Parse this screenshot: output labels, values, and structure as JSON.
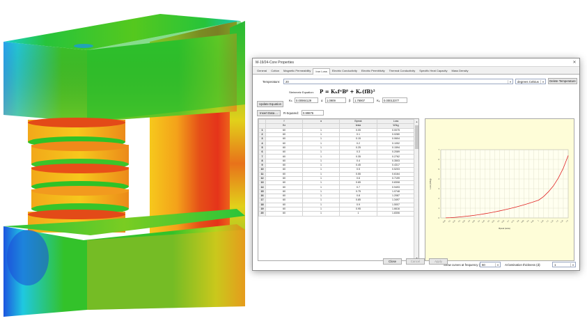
{
  "window": {
    "title": "M-19/24-Core Properties",
    "close_glyph": "✕"
  },
  "tabs": [
    {
      "label": "General"
    },
    {
      "label": "Cotton"
    },
    {
      "label": "Magnetic Permeability"
    },
    {
      "label": "Iron Loss",
      "active": true
    },
    {
      "label": "Electric Conductivity"
    },
    {
      "label": "Electric Permittivity"
    },
    {
      "label": "Thermal Conductivity"
    },
    {
      "label": "Specific Heat Capacity"
    },
    {
      "label": "Mass Density"
    }
  ],
  "temperature": {
    "label": "Temperature:",
    "value": "20",
    "unit": "degrees Celsius",
    "delete_button": "Delete Temperature"
  },
  "equation": {
    "label": "Steinmetz Equation:",
    "formula": "P = KₕfᵅBᵝ + Kₑ(fB)²",
    "update_button": "Update Equation",
    "params": [
      {
        "name": "Kₕ",
        "value": "0.00984129"
      },
      {
        "name": "α",
        "value": "1.0909"
      },
      {
        "name": "β",
        "value": "1.76907"
      },
      {
        "name": "Kₑ",
        "value": "0.00013377"
      }
    ]
  },
  "fit": {
    "insert_button": "Insert Data ...",
    "r_squared_label": "R-Squared:",
    "r_squared_value": "0.99876"
  },
  "table": {
    "headers": [
      "f",
      "α",
      "Bpeak",
      "Loss"
    ],
    "units": [
      "Hz",
      "",
      "tesla",
      "W/kg"
    ],
    "rows": [
      [
        "1",
        "60",
        "1",
        "0.05",
        "0.0075"
      ],
      [
        "2",
        "60",
        "1",
        "0.1",
        "0.0280"
      ],
      [
        "3",
        "60",
        "1",
        "0.15",
        "0.0604"
      ],
      [
        "4",
        "60",
        "1",
        "0.2",
        "0.1052"
      ],
      [
        "5",
        "60",
        "1",
        "0.25",
        "0.1594"
      ],
      [
        "6",
        "60",
        "1",
        "0.3",
        "0.2089"
      ],
      [
        "7",
        "60",
        "1",
        "0.35",
        "0.2762"
      ],
      [
        "8",
        "60",
        "1",
        "0.4",
        "0.3503"
      ],
      [
        "9",
        "60",
        "1",
        "0.45",
        "0.4317"
      ],
      [
        "10",
        "60",
        "1",
        "0.5",
        "0.5203"
      ],
      [
        "11",
        "60",
        "1",
        "0.55",
        "0.6164"
      ],
      [
        "12",
        "60",
        "1",
        "0.6",
        "0.7199"
      ],
      [
        "13",
        "60",
        "1",
        "0.65",
        "0.8308"
      ],
      [
        "14",
        "60",
        "1",
        "0.7",
        "0.9493"
      ],
      [
        "15",
        "60",
        "1",
        "0.75",
        "1.0748"
      ],
      [
        "16",
        "60",
        "1",
        "0.8",
        "1.2087"
      ],
      [
        "17",
        "60",
        "1",
        "0.85",
        "1.3497"
      ],
      [
        "18",
        "60",
        "1",
        "0.9",
        "1.5007"
      ],
      [
        "19",
        "60",
        "1",
        "0.95",
        "1.6616"
      ],
      [
        "20",
        "60",
        "1",
        "1",
        "1.8306"
      ]
    ]
  },
  "chart_data": {
    "type": "line",
    "xlabel": "Bpeak (tesla)",
    "ylabel": "Loss (W/kg)",
    "background": "#fefdd8",
    "line_color": "#e02020",
    "grid": true,
    "xlim": [
      0,
      1.3
    ],
    "ylim": [
      0,
      7
    ],
    "xticks": [
      "0.05",
      "0.1",
      "0.15",
      "0.2",
      "0.25",
      "0.3",
      "0.35",
      "0.4",
      "0.45",
      "0.5",
      "0.55",
      "0.6",
      "0.65",
      "0.7",
      "0.75",
      "0.8",
      "0.85",
      "0.9",
      "0.95",
      "1",
      "1.05",
      "1.1",
      "1.15",
      "1.2",
      "1.25",
      "1.3"
    ],
    "yticks": [
      "0",
      "1",
      "2",
      "3",
      "4",
      "5",
      "6",
      "7"
    ],
    "series": [
      {
        "x": [
          0.05,
          0.1,
          0.15,
          0.2,
          0.25,
          0.3,
          0.35,
          0.4,
          0.45,
          0.5,
          0.55,
          0.6,
          0.65,
          0.7,
          0.75,
          0.8,
          0.85,
          0.9,
          0.95,
          1,
          1.05,
          1.1,
          1.15,
          1.2,
          1.25,
          1.3
        ],
        "y": [
          0.0075,
          0.028,
          0.0604,
          0.1052,
          0.1594,
          0.2089,
          0.2762,
          0.3503,
          0.4317,
          0.5203,
          0.6164,
          0.7199,
          0.8308,
          0.9493,
          1.0748,
          1.2087,
          1.3497,
          1.5007,
          1.6616,
          1.8306,
          2.2,
          2.7,
          3.3,
          4.1,
          5.1,
          6.4
        ]
      }
    ]
  },
  "bottom": {
    "show_curves_label": "Show curves at frequency (f):",
    "frequency_value": "60",
    "lamination_label": "At lamination thickness (d):",
    "lamination_value": "1"
  },
  "footer": {
    "close": "Close",
    "cancel": "Cancel",
    "apply": "Apply"
  },
  "colors": {
    "sim_red": "#e8231a",
    "sim_orange": "#f29a1e",
    "sim_yellow": "#f4d21c",
    "sim_green": "#2ebd27",
    "sim_cyan": "#1fc7d8",
    "sim_blue": "#1c4bd8"
  }
}
